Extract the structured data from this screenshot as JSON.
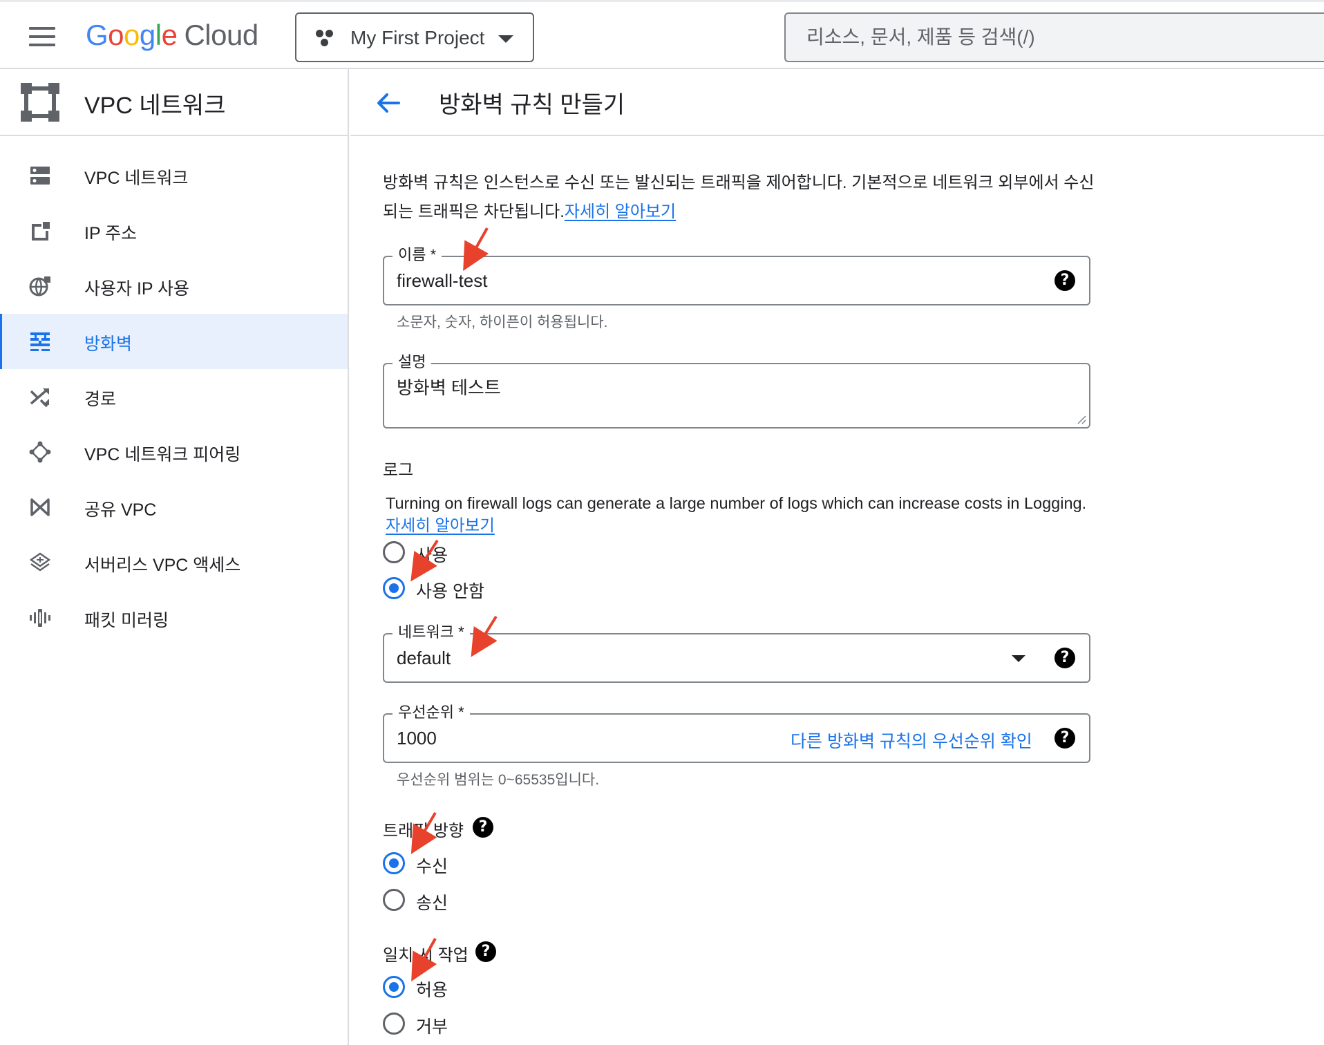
{
  "header": {
    "logo_google": "Google",
    "logo_cloud": "Cloud",
    "project": "My First Project",
    "search_placeholder": "리소스, 문서, 제품 등 검색(/)"
  },
  "sidebar": {
    "title": "VPC 네트워크",
    "items": [
      {
        "label": "VPC 네트워크",
        "icon": "vpc-network-icon"
      },
      {
        "label": "IP 주소",
        "icon": "ip-address-icon"
      },
      {
        "label": "사용자 IP 사용",
        "icon": "globe-icon"
      },
      {
        "label": "방화벽",
        "icon": "firewall-icon",
        "active": true
      },
      {
        "label": "경로",
        "icon": "route-shuffle-icon"
      },
      {
        "label": "VPC 네트워크 피어링",
        "icon": "peering-icon"
      },
      {
        "label": "공유 VPC",
        "icon": "shared-vpc-icon"
      },
      {
        "label": "서버리스 VPC 액세스",
        "icon": "serverless-icon"
      },
      {
        "label": "패킷 미러링",
        "icon": "packet-mirroring-icon"
      }
    ]
  },
  "main": {
    "title": "방화벽 규칙 만들기",
    "intro": "방화벽 규칙은 인스턴스로 수신 또는 발신되는 트래픽을 제어합니다. 기본적으로 네트워크 외부에서 수신되는 트래픽은 차단됩니다.",
    "intro_link": "자세히 알아보기",
    "name": {
      "label": "이름 *",
      "value": "firewall-test",
      "hint": "소문자, 숫자, 하이픈이 허용됩니다."
    },
    "description": {
      "label": "설명",
      "value": "방화벽 테스트"
    },
    "logs": {
      "title": "로그",
      "text": "Turning on firewall logs can generate a large number of logs which can increase costs in Logging.",
      "link": "자세히 알아보기",
      "options": [
        "사용",
        "사용 안함"
      ],
      "selected": "사용 안함"
    },
    "network": {
      "label": "네트워크 *",
      "value": "default"
    },
    "priority": {
      "label": "우선순위 *",
      "value": "1000",
      "link": "다른 방화벽 규칙의 우선순위 확인",
      "hint": "우선순위 범위는 0~65535입니다."
    },
    "direction": {
      "title": "트래픽 방향",
      "options": [
        "수신",
        "송신"
      ],
      "selected": "수신"
    },
    "action": {
      "title": "일치 시 작업",
      "options": [
        "허용",
        "거부"
      ],
      "selected": "허용"
    },
    "help_glyph": "?",
    "annotation_color": "#e8412c"
  }
}
